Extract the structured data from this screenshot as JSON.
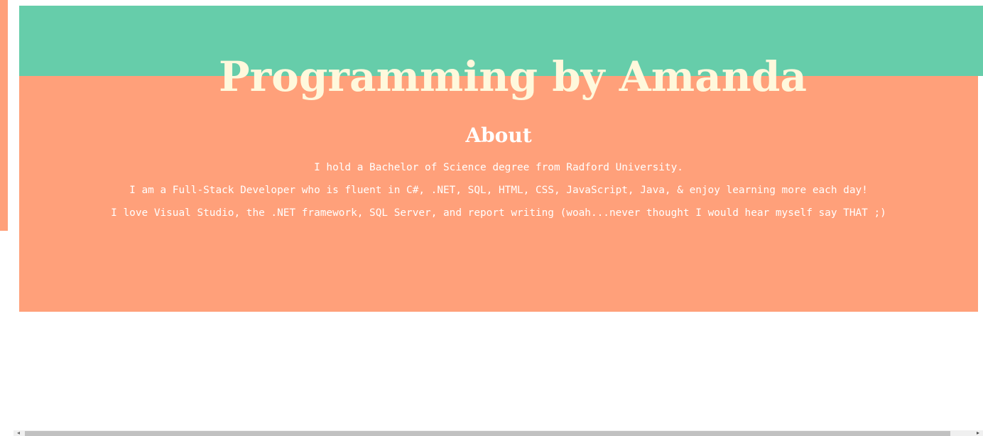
{
  "header": {
    "title": "Programming by Amanda"
  },
  "about": {
    "heading": "About",
    "lines": [
      "I hold a Bachelor of Science degree from Radford University.",
      "I am a Full-Stack Developer who is fluent in C#, .NET, SQL, HTML, CSS, JavaScript, Java, & enjoy learning more each day!",
      "I love Visual Studio, the .NET framework, SQL Server, and report writing (woah...never thought I would hear myself say THAT ;)"
    ]
  },
  "scrollbar": {
    "left_arrow_icon": "triangle-left",
    "right_arrow_icon": "triangle-right"
  },
  "colors": {
    "teal": "#66cdaa",
    "salmon": "#ffa07a",
    "title": "#fff8dc",
    "text": "#ffffff"
  }
}
